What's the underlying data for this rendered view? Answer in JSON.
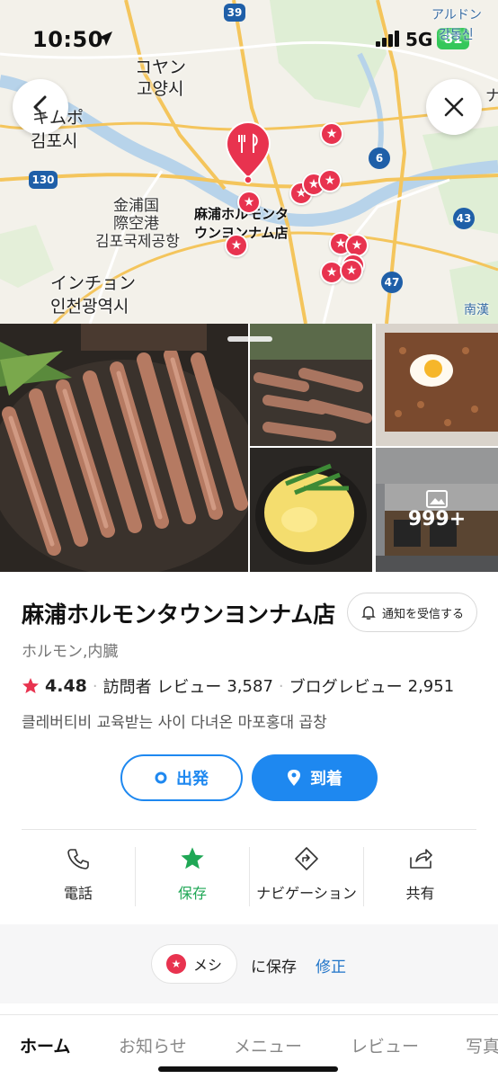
{
  "status_bar": {
    "time": "10:50",
    "network": "5G",
    "battery": "81"
  },
  "map": {
    "back_icon": "chevron-left-icon",
    "close_icon": "close-icon",
    "labels": {
      "goyang_jp": "コヤン",
      "goyang_kr": "고양시",
      "gimpo_jp": "キムポ",
      "gimpo_kr": "김포시",
      "airport_jp1": "金浦国",
      "airport_jp2": "際空港",
      "airport_kr": "김포국제공항",
      "incheon_jp": "インチョン",
      "incheon_kr": "인천광역시",
      "ardun": "アルドン",
      "gangdong": "강동신",
      "namhan": "南漢",
      "nam_partial": "ナ",
      "place_line1": "麻浦ホルモンタ",
      "place_line2": "ウンヨンナム店"
    },
    "roads": [
      "39",
      "130",
      "6",
      "43",
      "47"
    ]
  },
  "photos": {
    "more_count": "999+"
  },
  "place": {
    "title": "麻浦ホルモンタウンヨンナム店",
    "notify_label": "通知を受信する",
    "category": "ホルモン,内臓",
    "rating": "4.48",
    "visitor_reviews_label": "訪問者 レビュー",
    "visitor_reviews_count": "3,587",
    "blog_reviews_label": "ブログレビュー",
    "blog_reviews_count": "2,951",
    "description": "클레버티비 교육받는 사이 다녀온 마포홍대 곱창"
  },
  "route": {
    "depart": "出発",
    "arrive": "到着"
  },
  "actions": [
    {
      "label": "電話",
      "icon": "phone-icon"
    },
    {
      "label": "保存",
      "icon": "star-icon"
    },
    {
      "label": "ナビゲーション",
      "icon": "navigation-icon"
    },
    {
      "label": "共有",
      "icon": "share-icon"
    }
  ],
  "saved": {
    "list_name": "メシ",
    "save_suffix": "に保存",
    "edit": "修正"
  },
  "tabs": [
    "ホーム",
    "お知らせ",
    "メニュー",
    "レビュー",
    "写真"
  ],
  "colors": {
    "accent_blue": "#1e88f0",
    "pin_red": "#e8334f",
    "save_green": "#1fa755"
  }
}
